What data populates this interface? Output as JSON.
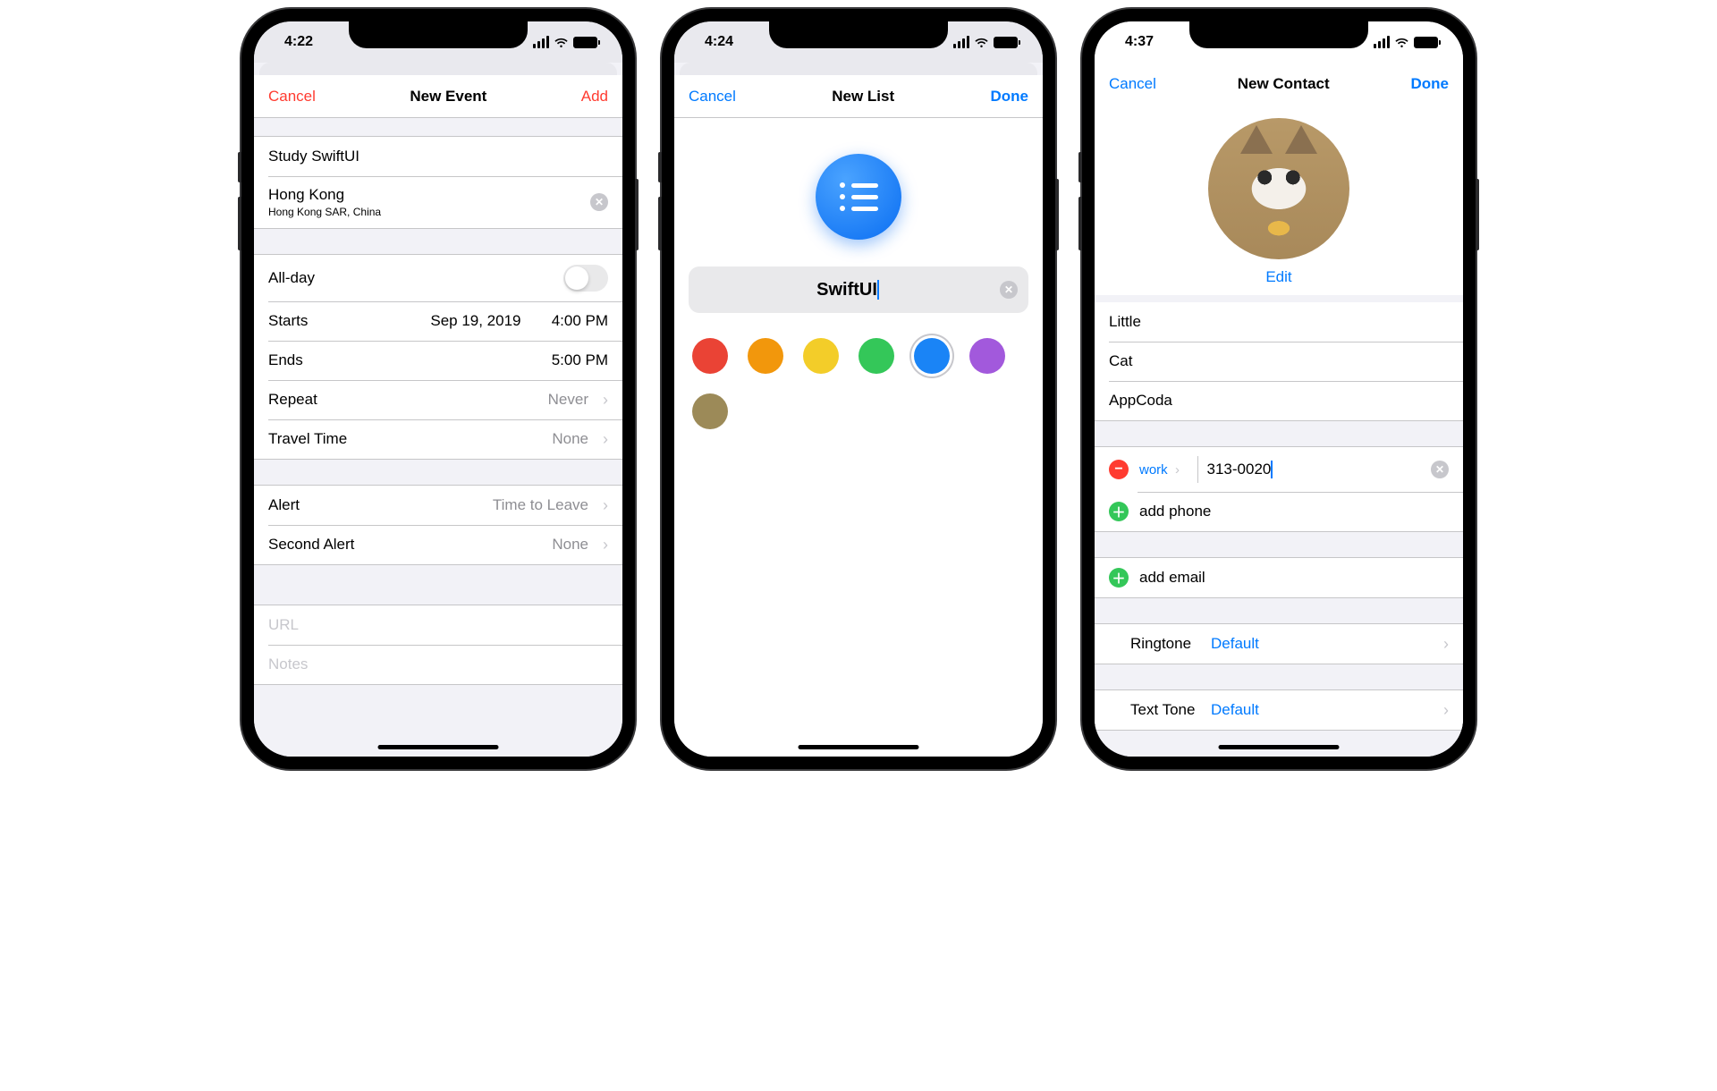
{
  "phone1": {
    "time": "4:22",
    "nav": {
      "left": "Cancel",
      "title": "New Event",
      "right": "Add"
    },
    "event_title": "Study SwiftUI",
    "location": "Hong Kong",
    "location_sub": "Hong Kong SAR, China",
    "allday_label": "All-day",
    "starts_label": "Starts",
    "starts_date": "Sep 19, 2019",
    "starts_time": "4:00 PM",
    "ends_label": "Ends",
    "ends_time": "5:00 PM",
    "repeat_label": "Repeat",
    "repeat_value": "Never",
    "travel_label": "Travel Time",
    "travel_value": "None",
    "alert_label": "Alert",
    "alert_value": "Time to Leave",
    "second_alert_label": "Second Alert",
    "second_alert_value": "None",
    "url_placeholder": "URL",
    "notes_placeholder": "Notes"
  },
  "phone2": {
    "time": "4:24",
    "nav": {
      "left": "Cancel",
      "title": "New List",
      "right": "Done"
    },
    "list_name": "SwiftUI",
    "colors": [
      {
        "hex": "#ea4335",
        "selected": false
      },
      {
        "hex": "#f2970c",
        "selected": false
      },
      {
        "hex": "#f3cd29",
        "selected": false
      },
      {
        "hex": "#34c759",
        "selected": false
      },
      {
        "hex": "#1a84f6",
        "selected": true
      },
      {
        "hex": "#a259dc",
        "selected": false
      },
      {
        "hex": "#9c8a58",
        "selected": false
      }
    ]
  },
  "phone3": {
    "time": "4:37",
    "nav": {
      "left": "Cancel",
      "title": "New Contact",
      "right": "Done"
    },
    "edit": "Edit",
    "first_name": "Little",
    "last_name": "Cat",
    "company": "AppCoda",
    "phone_type": "work",
    "phone_number": "313-0020",
    "add_phone": "add phone",
    "add_email": "add email",
    "ringtone_label": "Ringtone",
    "ringtone_value": "Default",
    "texttone_label": "Text Tone",
    "texttone_value": "Default"
  }
}
